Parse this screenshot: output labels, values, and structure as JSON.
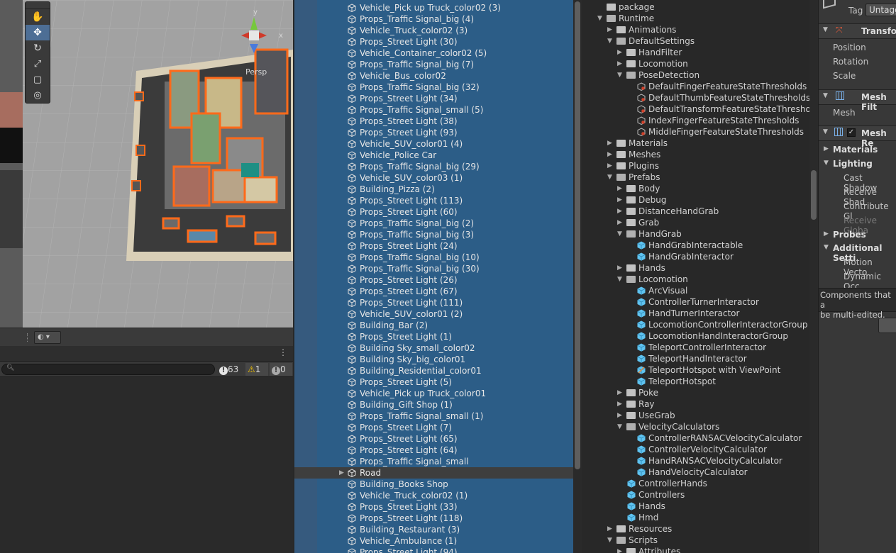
{
  "scene": {
    "persp_label": "Persp",
    "gizmo_axes": {
      "y": "y",
      "x": "x"
    },
    "tools": [
      "hand-tool",
      "move-tool",
      "rotate-tool",
      "scale-tool",
      "rect-tool",
      "transform-tool"
    ]
  },
  "console": {
    "search_placeholder": "",
    "counts": {
      "messages": "63",
      "warnings": "1",
      "errors": "0"
    }
  },
  "hierarchy": {
    "items": [
      "Vehicle_Pick up Truck_color02 (3)",
      "Props_Traffic Signal_big (4)",
      "Vehicle_Truck_color02 (3)",
      "Props_Street Light (30)",
      "Vehicle_Container_color02 (5)",
      "Props_Traffic Signal_big (7)",
      "Vehicle_Bus_color02",
      "Props_Traffic Signal_big (32)",
      "Props_Street Light (34)",
      "Props_Traffic Signal_small (5)",
      "Props_Street Light (38)",
      "Props_Street Light (93)",
      "Vehicle_SUV_color01 (4)",
      "Vehicle_Police Car",
      "Props_Traffic Signal_big (29)",
      "Vehicle_SUV_color03 (1)",
      "Building_Pizza (2)",
      "Props_Street Light (113)",
      "Props_Street Light (60)",
      "Props_Traffic Signal_big (2)",
      "Props_Traffic Signal_big (3)",
      "Props_Street Light (24)",
      "Props_Traffic Signal_big (10)",
      "Props_Traffic Signal_big (30)",
      "Props_Street Light (26)",
      "Props_Street Light (67)",
      "Props_Street Light (111)",
      "Vehicle_SUV_color01 (2)",
      "Building_Bar (2)",
      "Props_Street Light (1)",
      "Building Sky_small_color02",
      "Building Sky_big_color01",
      "Building_Residential_color01",
      "Props_Street Light (5)",
      "Vehicle_Pick up Truck_color01",
      "Building_Gift Shop (1)",
      "Props_Traffic Signal_small (1)",
      "Props_Street Light (7)",
      "Props_Street Light (65)",
      "Props_Street Light (64)",
      "Props_Traffic Signal_small",
      "Road",
      "Building_Books Shop",
      "Vehicle_Truck_color02 (1)",
      "Props_Street Light (33)",
      "Props_Street Light (118)",
      "Building_Restaurant (3)",
      "Vehicle_Ambulance (1)",
      "Props_Street Light (94)"
    ]
  },
  "project": {
    "items": [
      {
        "label": "package",
        "depth": 0,
        "kind": "folder",
        "expand": "none"
      },
      {
        "label": "Runtime",
        "depth": 0,
        "kind": "folder",
        "expand": "open"
      },
      {
        "label": "Animations",
        "depth": 1,
        "kind": "folder",
        "expand": "closed"
      },
      {
        "label": "DefaultSettings",
        "depth": 1,
        "kind": "folder",
        "expand": "open"
      },
      {
        "label": "HandFilter",
        "depth": 2,
        "kind": "folder",
        "expand": "closed"
      },
      {
        "label": "Locomotion",
        "depth": 2,
        "kind": "folder",
        "expand": "closed"
      },
      {
        "label": "PoseDetection",
        "depth": 2,
        "kind": "folder",
        "expand": "open"
      },
      {
        "label": "DefaultFingerFeatureStateThresholds",
        "depth": 3,
        "kind": "asset",
        "expand": "none"
      },
      {
        "label": "DefaultThumbFeatureStateThresholds",
        "depth": 3,
        "kind": "asset",
        "expand": "none"
      },
      {
        "label": "DefaultTransformFeatureStateThresho",
        "depth": 3,
        "kind": "asset",
        "expand": "none"
      },
      {
        "label": "IndexFingerFeatureStateThresholds",
        "depth": 3,
        "kind": "asset",
        "expand": "none"
      },
      {
        "label": "MiddleFingerFeatureStateThresholds",
        "depth": 3,
        "kind": "asset",
        "expand": "none"
      },
      {
        "label": "Materials",
        "depth": 1,
        "kind": "folder",
        "expand": "closed"
      },
      {
        "label": "Meshes",
        "depth": 1,
        "kind": "folder",
        "expand": "closed"
      },
      {
        "label": "Plugins",
        "depth": 1,
        "kind": "folder",
        "expand": "closed"
      },
      {
        "label": "Prefabs",
        "depth": 1,
        "kind": "folder",
        "expand": "open"
      },
      {
        "label": "Body",
        "depth": 2,
        "kind": "folder",
        "expand": "closed"
      },
      {
        "label": "Debug",
        "depth": 2,
        "kind": "folder",
        "expand": "closed"
      },
      {
        "label": "DistanceHandGrab",
        "depth": 2,
        "kind": "folder",
        "expand": "closed"
      },
      {
        "label": "Grab",
        "depth": 2,
        "kind": "folder",
        "expand": "closed"
      },
      {
        "label": "HandGrab",
        "depth": 2,
        "kind": "folder",
        "expand": "open"
      },
      {
        "label": "HandGrabInteractable",
        "depth": 3,
        "kind": "prefab",
        "expand": "none"
      },
      {
        "label": "HandGrabInteractor",
        "depth": 3,
        "kind": "prefab",
        "expand": "none"
      },
      {
        "label": "Hands",
        "depth": 2,
        "kind": "folder",
        "expand": "closed"
      },
      {
        "label": "Locomotion",
        "depth": 2,
        "kind": "folder",
        "expand": "open"
      },
      {
        "label": "ArcVisual",
        "depth": 3,
        "kind": "prefab",
        "expand": "none"
      },
      {
        "label": "ControllerTurnerInteractor",
        "depth": 3,
        "kind": "prefab",
        "expand": "none"
      },
      {
        "label": "HandTurnerInteractor",
        "depth": 3,
        "kind": "prefab",
        "expand": "none"
      },
      {
        "label": "LocomotionControllerInteractorGroup",
        "depth": 3,
        "kind": "prefab",
        "expand": "none"
      },
      {
        "label": "LocomotionHandInteractorGroup",
        "depth": 3,
        "kind": "prefab",
        "expand": "none"
      },
      {
        "label": "TeleportControllerInteractor",
        "depth": 3,
        "kind": "prefab",
        "expand": "none"
      },
      {
        "label": "TeleportHandInteractor",
        "depth": 3,
        "kind": "prefab",
        "expand": "none"
      },
      {
        "label": "TeleportHotspot with ViewPoint",
        "depth": 3,
        "kind": "variant",
        "expand": "none"
      },
      {
        "label": "TeleportHotspot",
        "depth": 3,
        "kind": "prefab",
        "expand": "none"
      },
      {
        "label": "Poke",
        "depth": 2,
        "kind": "folder",
        "expand": "closed"
      },
      {
        "label": "Ray",
        "depth": 2,
        "kind": "folder",
        "expand": "closed"
      },
      {
        "label": "UseGrab",
        "depth": 2,
        "kind": "folder",
        "expand": "closed"
      },
      {
        "label": "VelocityCalculators",
        "depth": 2,
        "kind": "folder",
        "expand": "open"
      },
      {
        "label": "ControllerRANSACVelocityCalculator",
        "depth": 3,
        "kind": "prefab",
        "expand": "none"
      },
      {
        "label": "ControllerVelocityCalculator",
        "depth": 3,
        "kind": "prefab",
        "expand": "none"
      },
      {
        "label": "HandRANSACVelocityCalculator",
        "depth": 3,
        "kind": "prefab",
        "expand": "none"
      },
      {
        "label": "HandVelocityCalculator",
        "depth": 3,
        "kind": "prefab",
        "expand": "none"
      },
      {
        "label": "ControllerHands",
        "depth": 2,
        "kind": "prefab",
        "expand": "none"
      },
      {
        "label": "Controllers",
        "depth": 2,
        "kind": "prefab",
        "expand": "none"
      },
      {
        "label": "Hands",
        "depth": 2,
        "kind": "prefab",
        "expand": "none"
      },
      {
        "label": "Hmd",
        "depth": 2,
        "kind": "prefab",
        "expand": "none"
      },
      {
        "label": "Resources",
        "depth": 1,
        "kind": "folder",
        "expand": "closed"
      },
      {
        "label": "Scripts",
        "depth": 1,
        "kind": "folder",
        "expand": "open"
      },
      {
        "label": "Attributes",
        "depth": 2,
        "kind": "folder",
        "expand": "closed"
      }
    ]
  },
  "inspector": {
    "tag_label": "Tag",
    "tag_value": "Untagg",
    "transform_title": "Transfor",
    "position": "Position",
    "rotation": "Rotation",
    "scale": "Scale",
    "mesh_filter_title": "Mesh Filt",
    "mesh": "Mesh",
    "mesh_renderer_title": "Mesh Re",
    "materials": "Materials",
    "lighting": "Lighting",
    "cast_shadows": "Cast Shadow",
    "receive_shadows": "Receive Shad",
    "contribute_gi": "Contribute Gl",
    "receive_gi": "Receive Globa",
    "probes": "Probes",
    "additional": "Additional Setti",
    "motion_vectors": "Motion Vecto",
    "dynamic_occ": "Dynamic Occ",
    "note_line1": "Components that a",
    "note_line2": "be multi-edited."
  }
}
